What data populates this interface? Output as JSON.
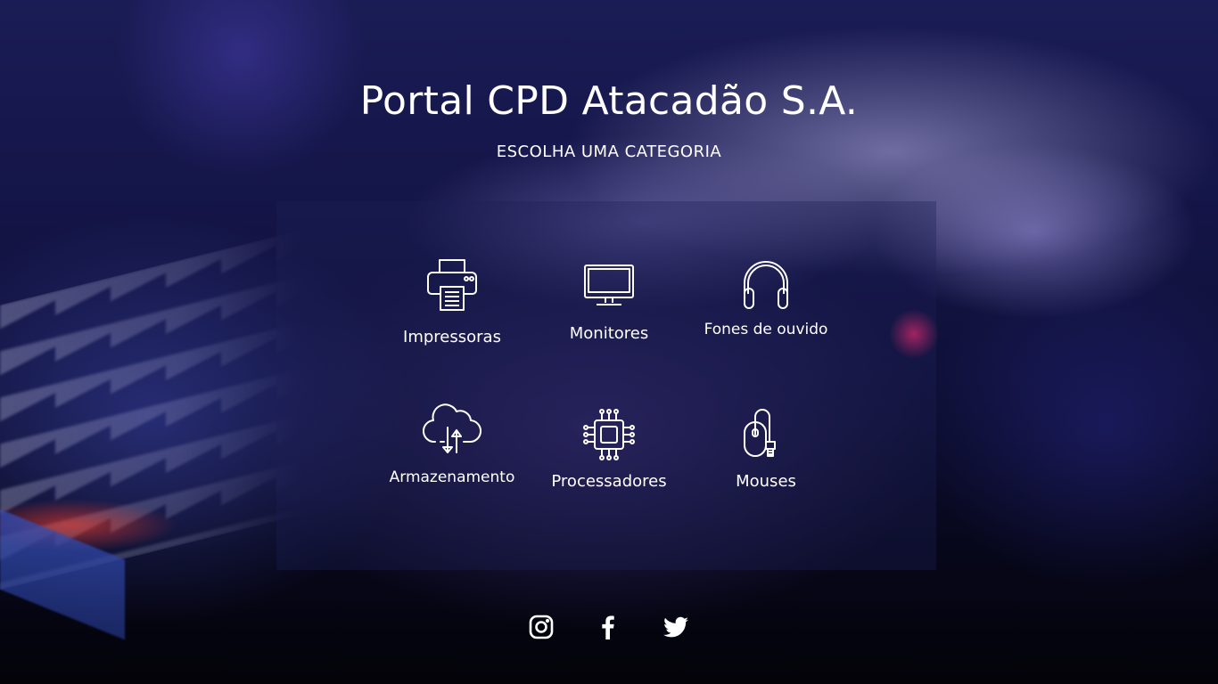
{
  "page": {
    "title": "Portal CPD Atacadão S.A.",
    "subtitle": "ESCOLHA UMA CATEGORIA"
  },
  "categories": [
    {
      "label": "Impressoras",
      "icon": "printer-icon"
    },
    {
      "label": "Monitores",
      "icon": "monitor-icon"
    },
    {
      "label": "Fones de ouvido",
      "icon": "headphones-icon"
    },
    {
      "label": "Armazenamento",
      "icon": "cloud-storage-icon"
    },
    {
      "label": "Processadores",
      "icon": "processor-chip-icon"
    },
    {
      "label": "Mouses",
      "icon": "mouse-icon"
    }
  ],
  "social": [
    {
      "icon": "instagram-icon"
    },
    {
      "icon": "facebook-icon"
    },
    {
      "icon": "twitter-icon"
    }
  ],
  "colors": {
    "text": "#ffffff",
    "background": "#0f1038",
    "panel": "#1e2055"
  }
}
